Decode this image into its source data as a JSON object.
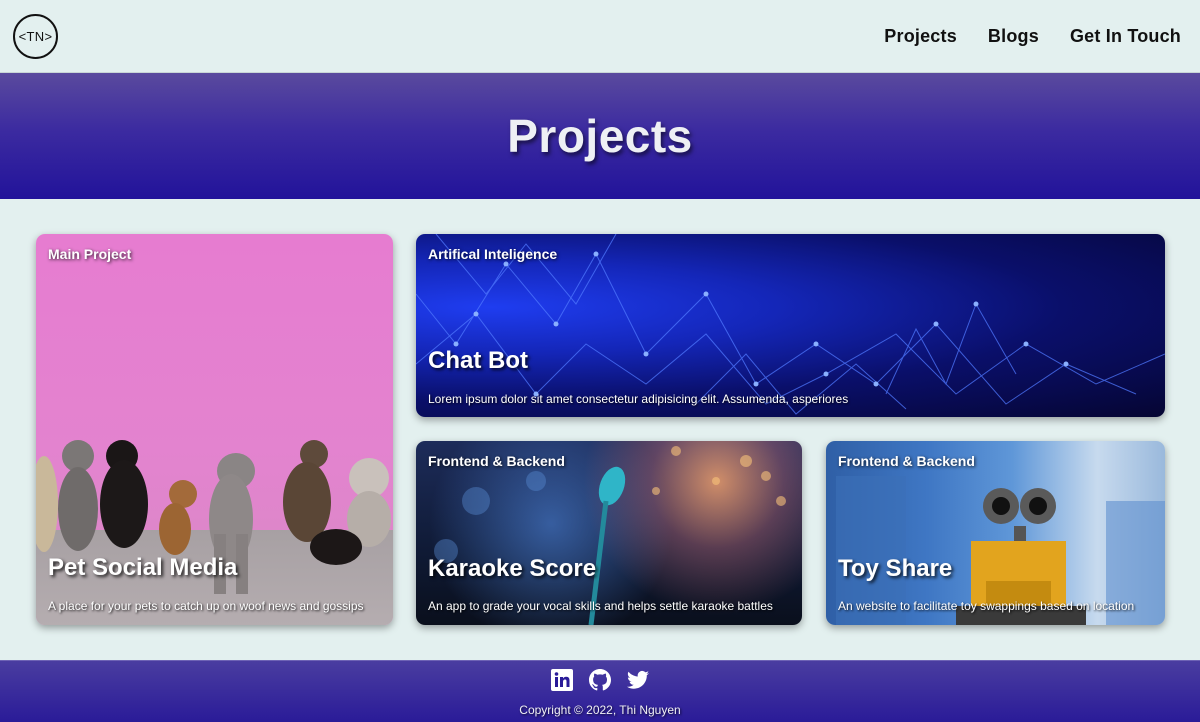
{
  "navbar": {
    "logo_text": "<TN>",
    "links": [
      "Projects",
      "Blogs",
      "Get In Touch"
    ]
  },
  "hero": {
    "title": "Projects"
  },
  "cards": [
    {
      "tag": "Main Project",
      "title": "Pet Social Media",
      "description": "A place for your pets to catch up on woof news and gossips",
      "image": "dogs-against-pink-wall"
    },
    {
      "tag": "Artifical Inteligence",
      "title": "Chat Bot",
      "description": "Lorem ipsum dolor sit amet consectetur adipisicing elit. Assumenda, asperiores",
      "image": "blue-network-plexus"
    },
    {
      "tag": "Frontend & Backend",
      "title": "Karaoke Score",
      "description": "An app to grade your vocal skills and helps settle karaoke battles",
      "image": "microphone-concert"
    },
    {
      "tag": "Frontend & Backend",
      "title": "Toy Share",
      "description": "An website to facilitate toy swappings based on location",
      "image": "robot-toy-city"
    }
  ],
  "footer": {
    "social_icons": [
      "linkedin-icon",
      "github-icon",
      "twitter-icon"
    ],
    "copyright": "Copyright © 2022, Thi Nguyen"
  },
  "colors": {
    "background": "#e3f0ef",
    "hero_gradient_top": "#5a4a9e",
    "hero_gradient_bottom": "#22139a",
    "footer": "#2a1b98"
  }
}
